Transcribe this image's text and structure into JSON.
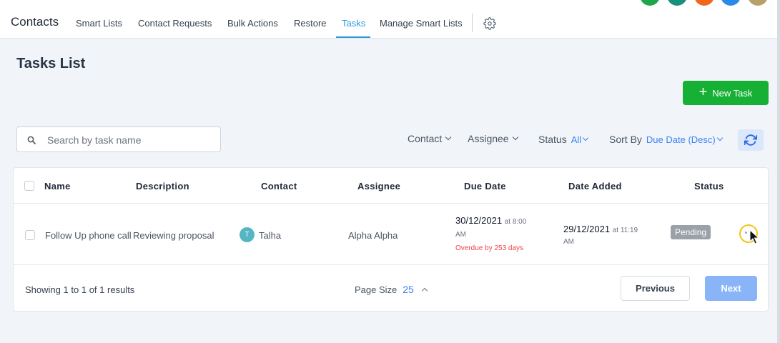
{
  "nav": {
    "brand": "Contacts",
    "tabs": [
      {
        "label": "Smart Lists"
      },
      {
        "label": "Contact Requests"
      },
      {
        "label": "Bulk Actions"
      },
      {
        "label": "Restore"
      },
      {
        "label": "Tasks",
        "active": true
      },
      {
        "label": "Manage Smart Lists"
      }
    ],
    "settings_icon": "gear-icon",
    "avatar_colors": [
      "#1fa64a",
      "#1a8f7a",
      "#f0661a",
      "#2b8ae8",
      "#b8a06a"
    ]
  },
  "page": {
    "title": "Tasks List",
    "new_task_label": "New Task"
  },
  "search": {
    "placeholder": "Search by task name",
    "value": ""
  },
  "filters": {
    "contact_label": "Contact",
    "assignee_label": "Assignee",
    "status_label": "Status",
    "status_value": "All",
    "sort_label": "Sort By",
    "sort_value": "Due Date (Desc)"
  },
  "table": {
    "columns": [
      "Name",
      "Description",
      "Contact",
      "Assignee",
      "Due Date",
      "Date Added",
      "Status"
    ],
    "rows": [
      {
        "name": "Follow Up phone call",
        "description": "Reviewing proposal",
        "contact_initial": "T",
        "contact": "Talha",
        "assignee": "Alpha Alpha",
        "due_date": "30/12/2021",
        "due_at": "at 8:00",
        "due_ampm": "AM",
        "overdue": "Overdue by 253 days",
        "date_added": "29/12/2021",
        "added_at": "at 11:19",
        "added_ampm": "AM",
        "status": "Pending"
      }
    ]
  },
  "footer": {
    "showing_prefix": "Showing",
    "from": "1",
    "to_word": "to",
    "to": "1",
    "of_word": "of",
    "total": "1",
    "results_word": "results",
    "page_size_label": "Page Size",
    "page_size": "25",
    "previous_label": "Previous",
    "next_label": "Next"
  },
  "colors": {
    "accent": "#2b9bd8",
    "primary_button": "#16b035",
    "link": "#3b82f6",
    "overdue": "#ef4444",
    "badge": "#9aa1a9",
    "next_button": "#8ab4f8"
  }
}
